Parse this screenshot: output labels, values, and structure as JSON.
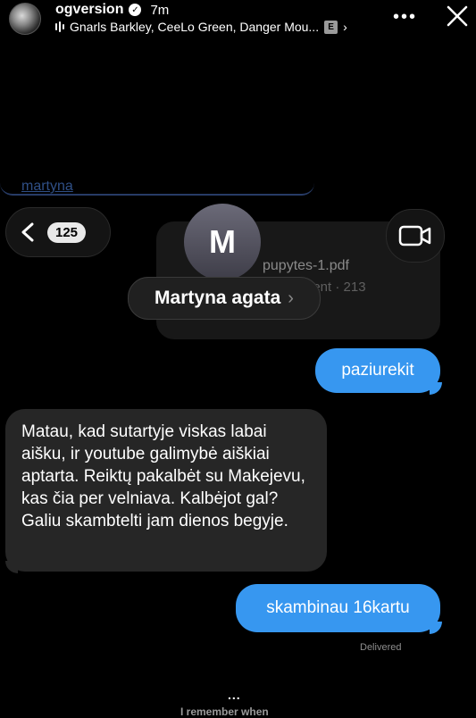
{
  "header": {
    "username": "ogversion",
    "time": "7m",
    "music": "Gnarls Barkley, CeeLo Green, Danger Mou...",
    "explicit_badge": "E",
    "more_icon": "more-horizontal-icon",
    "close_icon": "close-icon"
  },
  "chat": {
    "ghost_link": "martyna",
    "back_count": "125",
    "contact_initial": "M",
    "contact_name": "Martyna agata",
    "file": {
      "name": "pupytes-1.pdf",
      "meta": "cument · 213"
    },
    "messages": [
      {
        "from": "me",
        "text": "paziurekit"
      },
      {
        "from": "them",
        "text": "Matau, kad sutartyje viskas labai aišku, ir youtube galimybė aiškiai aptarta. Reiktų pakalbėt su Makejevu, kas čia per velniava. Kalbėjot gal? Galiu skambtelti jam dienos begyje."
      },
      {
        "from": "me",
        "text": "skambinau 16kartu"
      }
    ],
    "status": "Delivered"
  },
  "footer": {
    "dots": "...",
    "caption": "I remember when"
  },
  "colors": {
    "outgoing_bubble": "#3797f0",
    "incoming_bubble": "#262626",
    "background": "#000000"
  }
}
